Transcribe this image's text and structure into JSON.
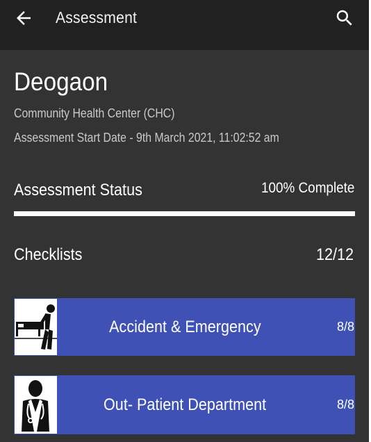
{
  "header": {
    "title": "Assessment",
    "back_icon": "arrow-left-icon",
    "search_icon": "search-icon"
  },
  "facility": {
    "name": "Deogaon",
    "type": "Community Health Center (CHC)",
    "start_date": "Assessment Start Date - 9th March 2021, 11:02:52 am"
  },
  "status": {
    "label": "Assessment Status",
    "value_text": "100% Complete",
    "progress_percent": 100
  },
  "checklists": {
    "label": "Checklists",
    "count": "12/12",
    "items": [
      {
        "title": "Accident & Emergency",
        "count": "8/8",
        "icon": "stretcher-patient-icon"
      },
      {
        "title": "Out- Patient Department",
        "count": "8/8",
        "icon": "doctor-icon"
      }
    ]
  },
  "colors": {
    "app_bar": "#212121",
    "background": "#333333",
    "card": "#3f51b5",
    "text": "#ffffff",
    "subtext": "#c9c9c9"
  }
}
